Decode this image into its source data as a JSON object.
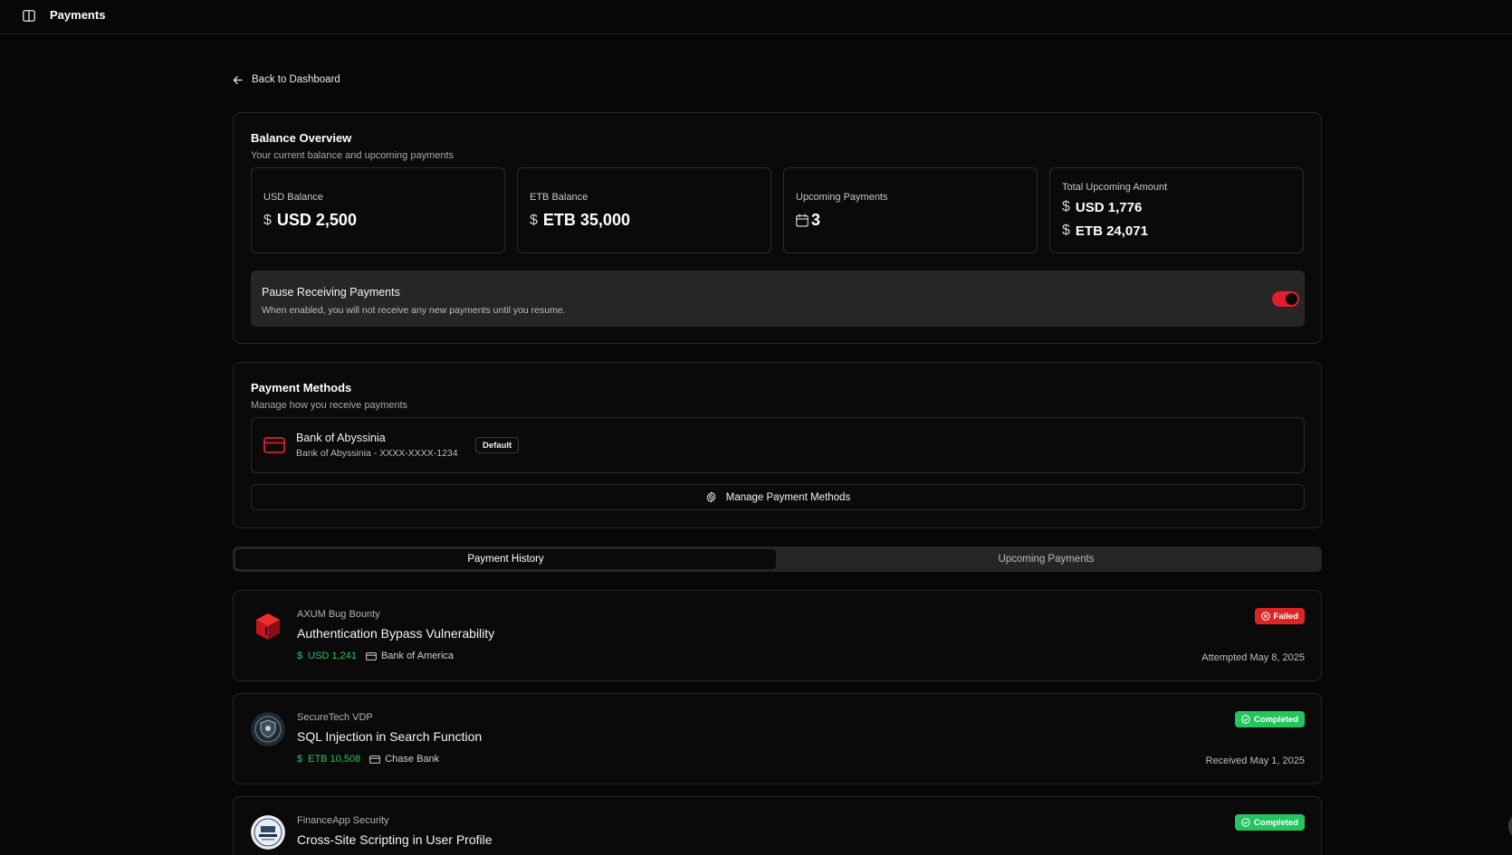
{
  "header": {
    "title": "Payments",
    "toggle_icon": "sidebar-toggle-icon"
  },
  "nav": {
    "back_label": "Back to Dashboard"
  },
  "balance_overview": {
    "title": "Balance Overview",
    "subtitle": "Your current balance and upcoming payments",
    "stats": [
      {
        "label": "USD Balance",
        "value": "USD 2,500"
      },
      {
        "label": "ETB Balance",
        "value": "ETB 35,000"
      },
      {
        "label": "Upcoming Payments",
        "value": "3"
      },
      {
        "label": "Total Upcoming Amount",
        "values": [
          "USD 1,776",
          "ETB 24,071"
        ]
      }
    ],
    "pause": {
      "title": "Pause Receiving Payments",
      "description": "When enabled, you will not receive any new payments until you resume.",
      "enabled": true
    }
  },
  "payment_methods": {
    "title": "Payment Methods",
    "subtitle": "Manage how you receive payments",
    "methods": [
      {
        "name": "Bank of Abyssinia",
        "detail": "Bank of Abyssinia - XXXX-XXXX-1234",
        "badge": "Default"
      }
    ],
    "manage_label": "Manage Payment Methods"
  },
  "tabs": [
    {
      "label": "Payment History",
      "active": true
    },
    {
      "label": "Upcoming Payments",
      "active": false
    }
  ],
  "payments": [
    {
      "program": "AXUM Bug Bounty",
      "title": "Authentication Bypass Vulnerability",
      "amount": "USD 1,241",
      "bank": "Bank of America",
      "status": "Failed",
      "date": "Attempted May 8, 2025"
    },
    {
      "program": "SecureTech VDP",
      "title": "SQL Injection in Search Function",
      "amount": "ETB 10,508",
      "bank": "Chase Bank",
      "status": "Completed",
      "date": "Received May 1, 2025"
    },
    {
      "program": "FinanceApp Security",
      "title": "Cross-Site Scripting in User Profile",
      "status": "Completed"
    }
  ],
  "colors": {
    "background": "#070707",
    "accent_red": "#e01e2d",
    "success_green": "#22c55e",
    "panel": "#262626"
  }
}
